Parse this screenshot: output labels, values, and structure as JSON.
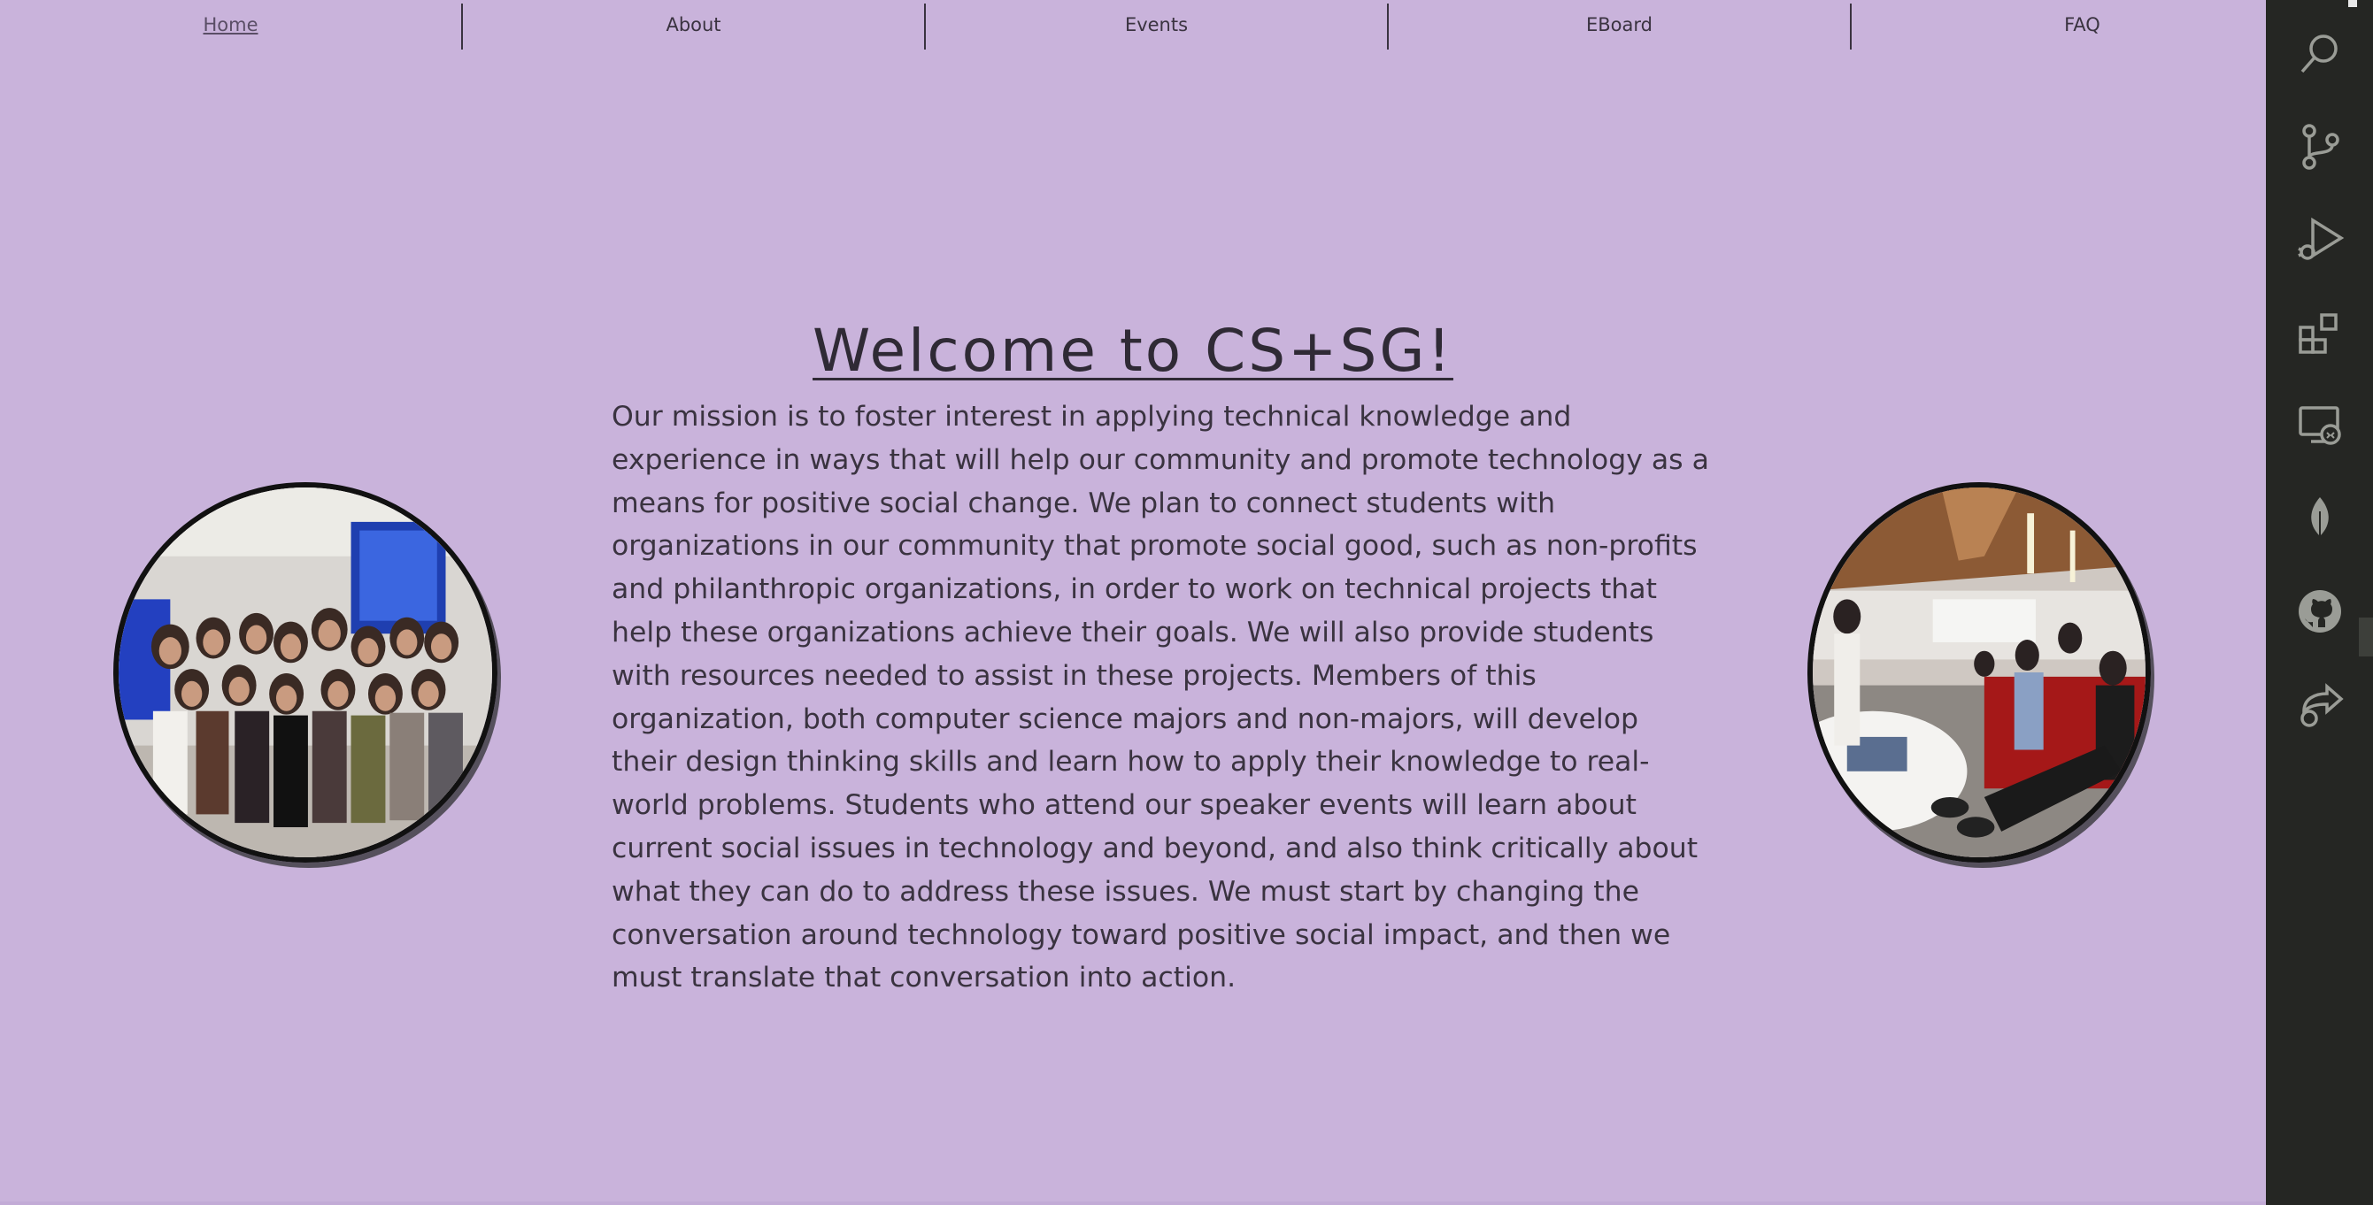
{
  "nav": {
    "items": [
      {
        "label": "Home",
        "active": true
      },
      {
        "label": "About",
        "active": false
      },
      {
        "label": "Events",
        "active": false
      },
      {
        "label": "EBoard",
        "active": false
      },
      {
        "label": "FAQ",
        "active": false
      }
    ]
  },
  "hero": {
    "title": "Welcome to CS+SG!",
    "mission": "Our mission is to foster interest in applying technical knowledge and experience in ways that will help our community and promote technology as a means for positive social change. We plan to connect students with organizations in our community that promote social good, such as non-profits and philanthropic organizations, in order to work on technical projects that help these organizations achieve their goals. We will also provide students with resources needed to assist in these projects. Members of this organization, both computer science majors and non-majors, will develop their design thinking skills and learn how to apply their knowledge to real-world problems. Students who attend our speaker events will learn about current social issues in technology and beyond, and also think critically about what they can do to address these issues. We must start by changing the conversation around technology toward positive social impact, and then we must translate that conversation into action."
  },
  "activity_bar": {
    "icons": [
      "search-icon",
      "source-control-icon",
      "run-debug-icon",
      "extensions-icon",
      "remote-explorer-icon",
      "mongodb-leaf-icon",
      "github-icon",
      "live-share-icon"
    ]
  },
  "colors": {
    "page_background": "#c9b3db",
    "text": "#3a3340",
    "activity_bar": "#252623",
    "icon": "#9a9c96"
  }
}
